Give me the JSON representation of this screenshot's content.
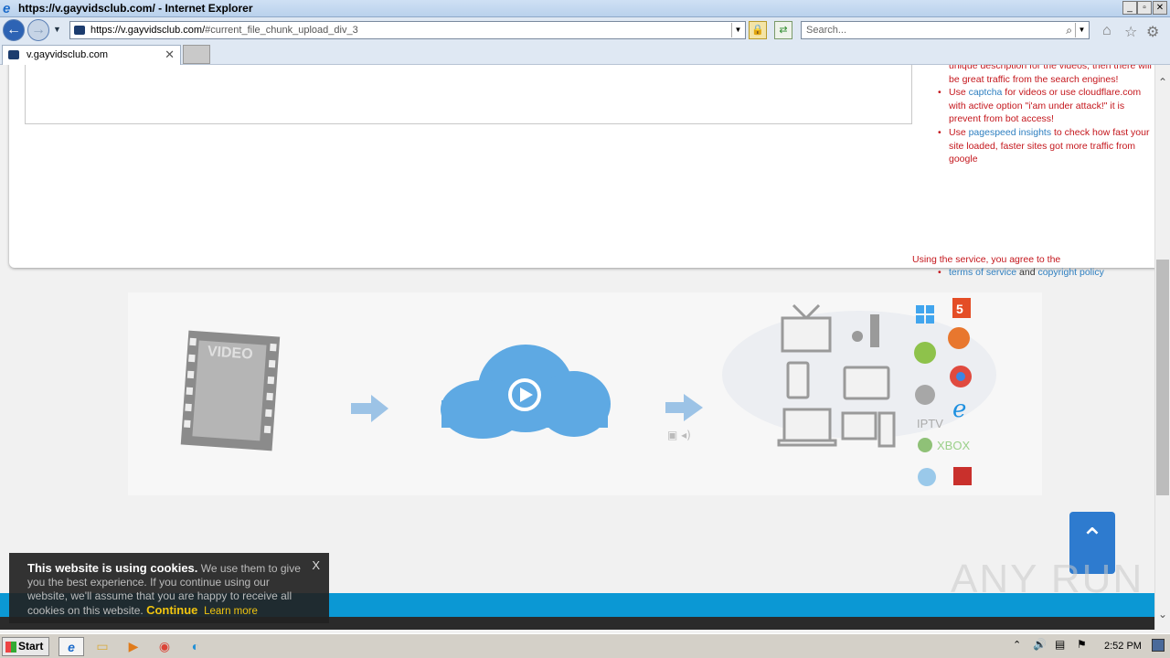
{
  "window": {
    "title": "https://v.gayvidsclub.com/ - Internet Explorer",
    "min": "_",
    "max": "▫",
    "close": "✕"
  },
  "navbar": {
    "url_host": "https://v.gayvidsclub.com/",
    "url_path": "#current_file_chunk_upload_div_3",
    "search_placeholder": "Search..."
  },
  "tab": {
    "label": "v.gayvidsclub.com",
    "close": "✕"
  },
  "tips": {
    "item0": "unique description for the videos, then there will be great traffic from the search engines!",
    "item1_pre": "Use ",
    "item1_link": "captcha",
    "item1_post": " for videos or use cloudflare.com with active option \"i'am under attack!\" it is prevent from bot access!",
    "item2_pre": "Use ",
    "item2_link": "pagespeed insights",
    "item2_post": " to check how fast your site loaded, faster sites got more traffic from google"
  },
  "agree": {
    "text": "Using the service, you agree to the",
    "tos": "terms of service",
    "and": " and ",
    "copyright": "copyright policy"
  },
  "hero": {
    "film_label": "VIDEO",
    "iptv": "IPTV",
    "xbox": "XBOX"
  },
  "cookie": {
    "heading": "This website is using cookies.",
    "body": " We use them to give you the best experience. If you continue using our website, we'll assume that you are happy to receive all cookies on this website. ",
    "continue": "Continue",
    "learn": "Learn more",
    "close": "X"
  },
  "watermark": "ANY RUN",
  "taskbar": {
    "start": "Start",
    "clock": "2:52 PM"
  },
  "colors": {
    "accent_blue": "#0b98d4",
    "tip_red": "#c4161c",
    "link_blue": "#2e7fc0",
    "to_top": "#2e7bcf"
  }
}
